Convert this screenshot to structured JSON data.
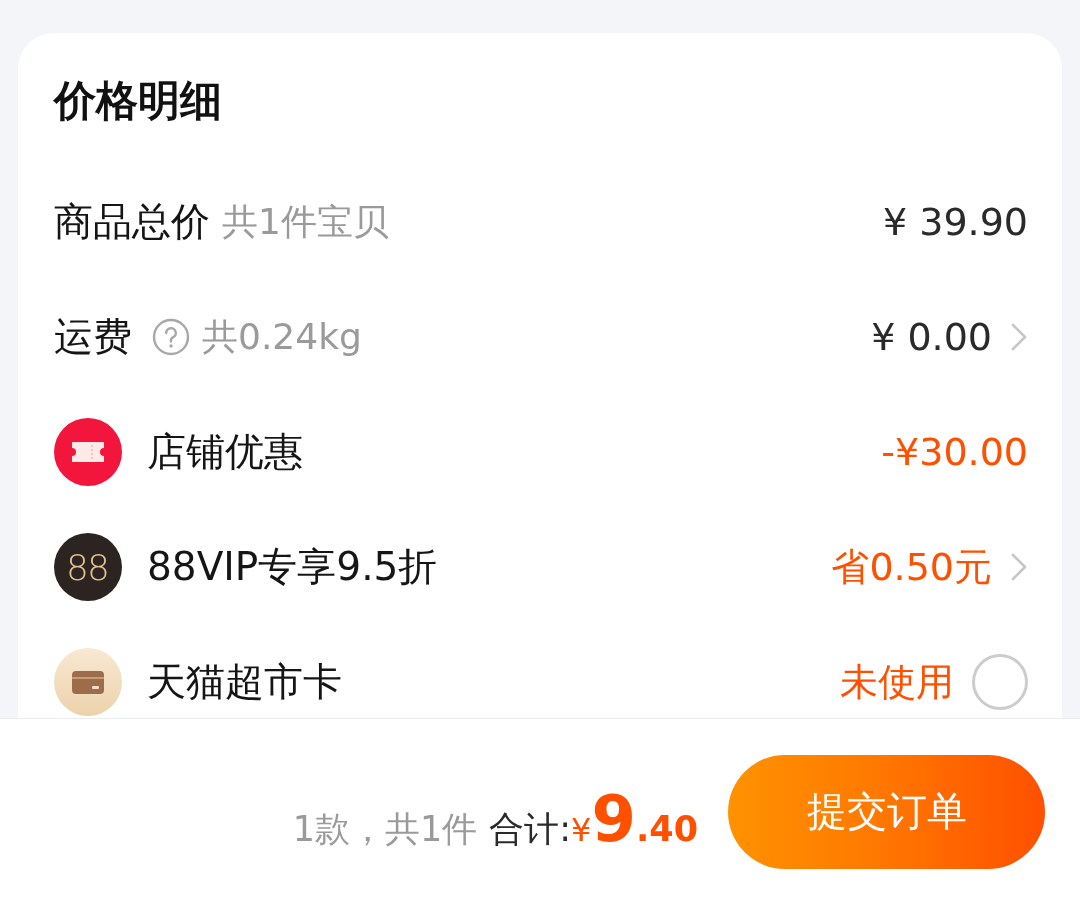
{
  "section": {
    "title": "价格明细"
  },
  "rows": [
    {
      "kind": "plain",
      "label": "商品总价",
      "note": "共1件宝贝",
      "value": "¥ 39.90",
      "highlighted": false,
      "chevron": false
    },
    {
      "kind": "help",
      "label": "运费",
      "note": "共0.24kg",
      "value": "¥ 0.00",
      "highlighted": false,
      "chevron": true
    },
    {
      "kind": "ticket",
      "label": "店铺优惠",
      "value": "-¥30.00",
      "highlighted": true,
      "chevron": false
    },
    {
      "kind": "badge",
      "badge_text": "88",
      "label": "88VIP专享9.5折",
      "value": "省0.50元",
      "highlighted": true,
      "chevron": true
    },
    {
      "kind": "card",
      "label": "天猫超市卡",
      "value": "未使用",
      "highlighted": true,
      "chevron": false,
      "toggle": {
        "checked": false
      }
    }
  ],
  "footer": {
    "count": "1款，共1件",
    "total_label": "合计:",
    "currency": "¥",
    "total_integer": "9",
    "total_decimal": ".40",
    "submit_button": "提交订单"
  }
}
